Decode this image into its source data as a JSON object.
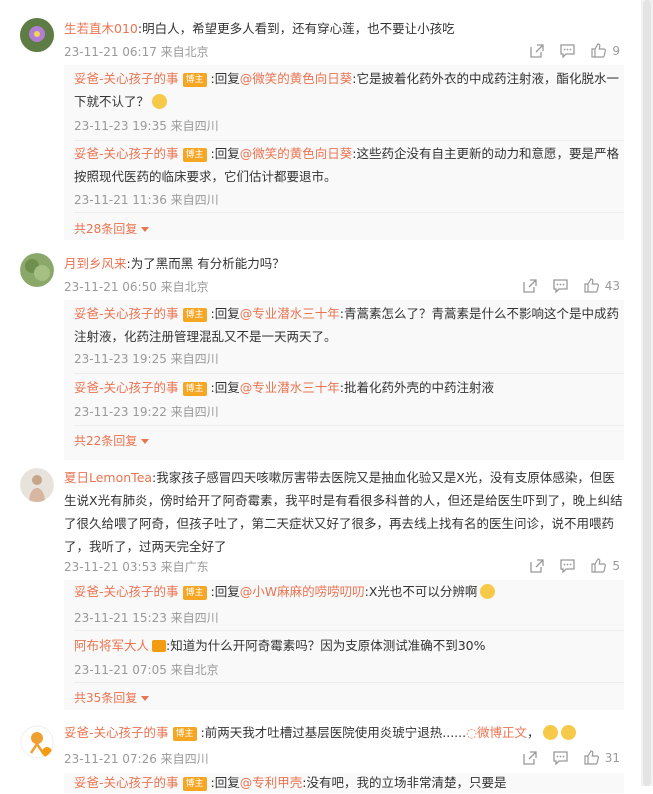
{
  "comments": [
    {
      "user": "生若直木010",
      "text": ":明白人，希望更多人看到，还有穿心莲，也不要让小孩吃",
      "time": "23-11-21 06:17 来自北京",
      "likes": "9",
      "replies": [
        {
          "user": "妥爸-关心孩子的事",
          "badge": "博主",
          "prefix": ":回复",
          "mention": "@微笑的黄色向日葵",
          "text": ":它是披着化药外衣的中成药注射液，酯化脱水一下就不认了？",
          "time": "23-11-23 19:35 来自四川"
        },
        {
          "user": "妥爸-关心孩子的事",
          "badge": "博主",
          "prefix": ":回复",
          "mention": "@微笑的黄色向日葵",
          "text": ":这些药企没有自主更新的动力和意愿，要是严格按照现代医药的临床要求，它们估计都要退市。",
          "time": "23-11-21 11:36 来自四川"
        }
      ],
      "more": "共28条回复"
    },
    {
      "user": "月到乡风来",
      "text": ":为了黑而黑 有分析能力吗？",
      "time": "23-11-21 06:50 来自北京",
      "likes": "43",
      "replies": [
        {
          "user": "妥爸-关心孩子的事",
          "badge": "博主",
          "prefix": ":回复",
          "mention": "@专业潜水三十年",
          "text": ":青蒿素怎么了？青蒿素是什么不影响这个是中成药注射液，化药注册管理混乱又不是一天两天了。",
          "time": "23-11-23 19:25 来自四川"
        },
        {
          "user": "妥爸-关心孩子的事",
          "badge": "博主",
          "prefix": ":回复",
          "mention": "@专业潜水三十年",
          "text": ":批着化药外壳的中药注射液",
          "time": "23-11-23 19:22 来自四川"
        }
      ],
      "more": "共22条回复"
    },
    {
      "user": "夏日LemonTea",
      "text": ":我家孩子感冒四天咳嗽厉害带去医院又是抽血化验又是X光，没有支原体感染，但医生说X光有肺炎，傍时给开了阿奇霉素，我平时是有看很多科普的人，但还是给医生吓到了，晚上纠结了很久给喂了阿奇，但孩子吐了，第二天症状又好了很多，再去线上找有名的医生问诊，说不用喂药了，我听了，过两天完全好了",
      "time": "23-11-21 03:53 来自广东",
      "likes": "5",
      "replies": [
        {
          "user": "妥爸-关心孩子的事",
          "badge": "博主",
          "prefix": ":回复",
          "mention": "@小W麻麻的唠唠叨叨",
          "text": ":X光也不可以分辨啊",
          "time": "23-11-21 15:23 来自四川"
        },
        {
          "user": "阿布将军大人",
          "badge": "",
          "prefix": "",
          "mention": "",
          "text": ":知道为什么开阿奇霉素吗？因为支原体测试准确不到30%",
          "time": "23-11-21 07:05 来自北京"
        }
      ],
      "more": "共35条回复"
    },
    {
      "user": "妥爸-关心孩子的事",
      "badge": "博主",
      "text": ":前两天我才吐槽过基层医院使用炎琥宁退热......",
      "link": "微博正文",
      "time": "23-11-21 07:26 来自四川",
      "likes": "31",
      "partial_reply": {
        "user": "妥爸-关心孩子的事",
        "badge": "博主",
        "prefix": ":回复",
        "mention": "@专利甲壳",
        "text": ":没有吧，我的立场非常清楚，只要是"
      }
    }
  ],
  "icons": {
    "share": "share-icon",
    "comment": "comment-icon",
    "like": "like-icon"
  },
  "colors": {
    "accent": "#eb7350",
    "meta": "#999999",
    "badge": "#f5a623"
  }
}
